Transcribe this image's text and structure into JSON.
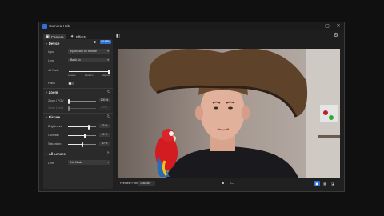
{
  "window": {
    "title": "Camera Hub",
    "controls": {
      "minimize": "—",
      "maximize": "▢",
      "close": "✕"
    }
  },
  "tabs": [
    {
      "label": "Camera",
      "icon": "camera-icon",
      "active": true
    },
    {
      "label": "Effects",
      "icon": "wand-icon",
      "active": false
    }
  ],
  "sidebar": {
    "learn_label": "LEARN",
    "device": {
      "title": "Device",
      "input_label": "Input",
      "input_value": "EpocCam on iPhone",
      "lens_label": "Lens",
      "lens_value": "Back 1x",
      "hdr_label": "4K Fade",
      "resolution_options": [
        "Lowest",
        "Medium",
        "Highest"
      ],
      "resolution_level": 1.0,
      "flash_label": "Flash",
      "flash_on": false
    },
    "zoom": {
      "title": "Zoom",
      "zoom_label": "Zoom / FOV",
      "zoom_value": "100 %",
      "second_label": "Zoom Level",
      "second_value": "0 %"
    },
    "picture": {
      "title": "Picture",
      "brightness_label": "Brightness",
      "brightness_value": "75 %",
      "brightness_level": 0.75,
      "contrast_label": "Contrast",
      "contrast_value": "60 %",
      "contrast_level": 0.6,
      "saturation_label": "Saturation",
      "saturation_value": "50 %",
      "saturation_level": 0.5
    },
    "all_lenses": {
      "title": "All Lenses",
      "lens_label": "Lens",
      "lens_value": "No Mask"
    }
  },
  "bottom_bar": {
    "preview_format_label": "Preview Format",
    "preview_format_value": "1080p60",
    "view_modes": [
      "single",
      "grid",
      "split"
    ],
    "active_view": "single"
  },
  "colors": {
    "accent": "#2f6fd6",
    "window_bg": "#202020",
    "panel_bg": "#2a2a2a"
  }
}
